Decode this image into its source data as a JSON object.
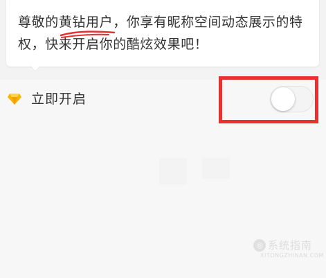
{
  "notice": {
    "text_before": "尊敬的",
    "highlight": "黄钻用户",
    "text_after": "，你享有昵称空间动态展示的特权，快来开启你的酷炫效果吧！"
  },
  "setting": {
    "icon": "yellow-diamond-icon",
    "label": "立即开启",
    "toggle_state": "off"
  },
  "annotation": {
    "box_color": "#e8312f",
    "underline_color": "#e8312f"
  },
  "watermark": {
    "icon_glyph": "◎",
    "text": "系统指南",
    "url": "XITONGZHINAN.COM"
  }
}
